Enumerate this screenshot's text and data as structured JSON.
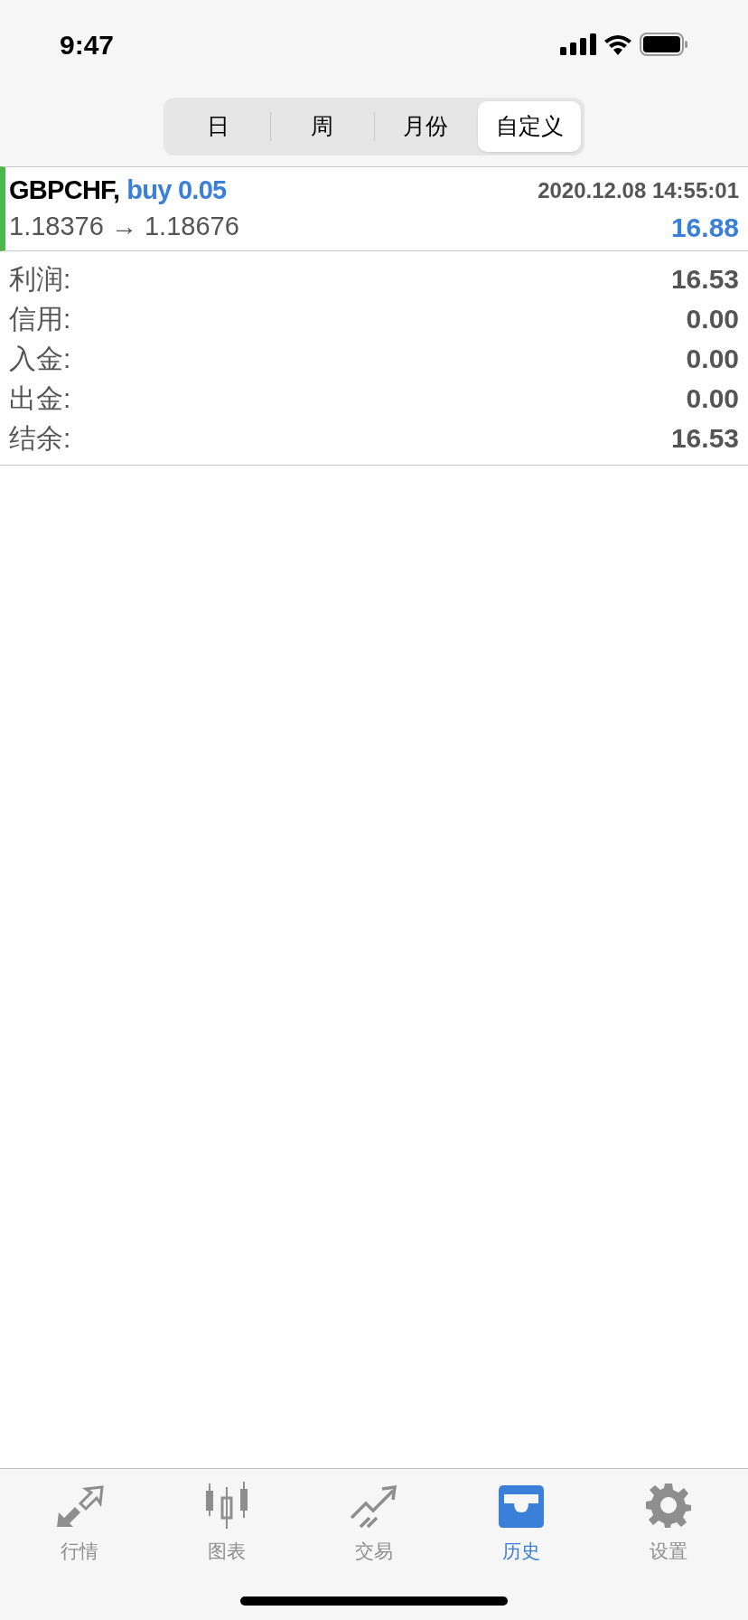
{
  "status_bar": {
    "time": "9:47"
  },
  "period_tabs": [
    {
      "label": "日",
      "selected": false
    },
    {
      "label": "周",
      "selected": false
    },
    {
      "label": "月份",
      "selected": false
    },
    {
      "label": "自定义",
      "selected": true
    }
  ],
  "trade": {
    "symbol": "GBPCHF,",
    "action": "buy 0.05",
    "time": "2020.12.08 14:55:01",
    "prices": "1.18376 → 1.18676",
    "profit": "16.88"
  },
  "summary": [
    {
      "label": "利润:",
      "value": "16.53"
    },
    {
      "label": "信用:",
      "value": "0.00"
    },
    {
      "label": "入金:",
      "value": "0.00"
    },
    {
      "label": "出金:",
      "value": "0.00"
    },
    {
      "label": "结余:",
      "value": "16.53"
    }
  ],
  "bottom_tabs": [
    {
      "kind": "quotes",
      "label": "行情",
      "selected": false
    },
    {
      "kind": "chart",
      "label": "图表",
      "selected": false
    },
    {
      "kind": "trade",
      "label": "交易",
      "selected": false
    },
    {
      "kind": "history",
      "label": "历史",
      "selected": true
    },
    {
      "kind": "settings",
      "label": "设置",
      "selected": false
    }
  ]
}
